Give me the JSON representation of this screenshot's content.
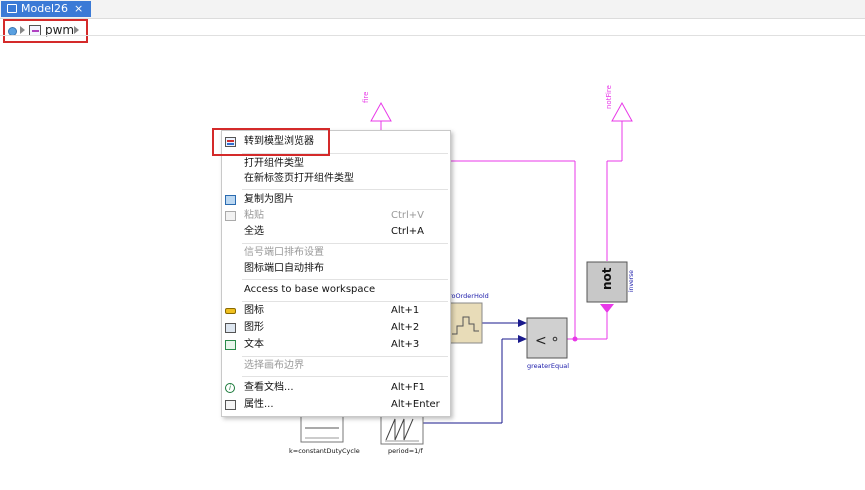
{
  "tab": {
    "title": "Model26",
    "close": "×"
  },
  "breadcrumb": {
    "model_name": "pwm"
  },
  "diagram": {
    "fire_label": "fire",
    "notfire_label": "notFire",
    "not_block_text": "not",
    "inverse_label": "inverse",
    "zoh_label": "zeroOrderHold",
    "zoh_label_visible": "roOrderHold",
    "greater_label": "greaterEqual",
    "greater_symbol": "<",
    "const_label": "k=constantDutyCycle",
    "saw_label": "period=1/f",
    "colors": {
      "signal_pink": "#e838e8",
      "real_blue": "#1a1a8c",
      "block_gray": "#c8c8c8",
      "zoh_fill": "#e8dcb8"
    }
  },
  "context_menu": {
    "items": [
      {
        "label": "转到模型浏览器",
        "shortcut": "",
        "disabled": false,
        "icon": "model-browser-icon"
      },
      {
        "label": "打开组件类型",
        "shortcut": "",
        "disabled": false,
        "icon": ""
      },
      {
        "label": "在新标签页打开组件类型",
        "shortcut": "",
        "disabled": false,
        "icon": ""
      },
      {
        "label": "复制为图片",
        "shortcut": "",
        "disabled": false,
        "icon": "copy-image-icon"
      },
      {
        "label": "粘贴",
        "shortcut": "Ctrl+V",
        "disabled": true,
        "icon": "paste-icon"
      },
      {
        "label": "全选",
        "shortcut": "Ctrl+A",
        "disabled": false,
        "icon": ""
      },
      {
        "label": "信号端口排布设置",
        "shortcut": "",
        "disabled": true,
        "icon": ""
      },
      {
        "label": "图标端口自动排布",
        "shortcut": "",
        "disabled": false,
        "icon": ""
      },
      {
        "label": "Access to base workspace",
        "shortcut": "",
        "disabled": false,
        "icon": ""
      },
      {
        "label": "图标",
        "shortcut": "Alt+1",
        "disabled": false,
        "icon": "icon-view-icon"
      },
      {
        "label": "图形",
        "shortcut": "Alt+2",
        "disabled": false,
        "icon": "diagram-view-icon"
      },
      {
        "label": "文本",
        "shortcut": "Alt+3",
        "disabled": false,
        "icon": "text-view-icon"
      },
      {
        "label": "选择画布边界",
        "shortcut": "",
        "disabled": true,
        "icon": ""
      },
      {
        "label": "查看文档...",
        "shortcut": "Alt+F1",
        "disabled": false,
        "icon": "info-icon"
      },
      {
        "label": "属性...",
        "shortcut": "Alt+Enter",
        "disabled": false,
        "icon": "properties-icon"
      }
    ]
  }
}
